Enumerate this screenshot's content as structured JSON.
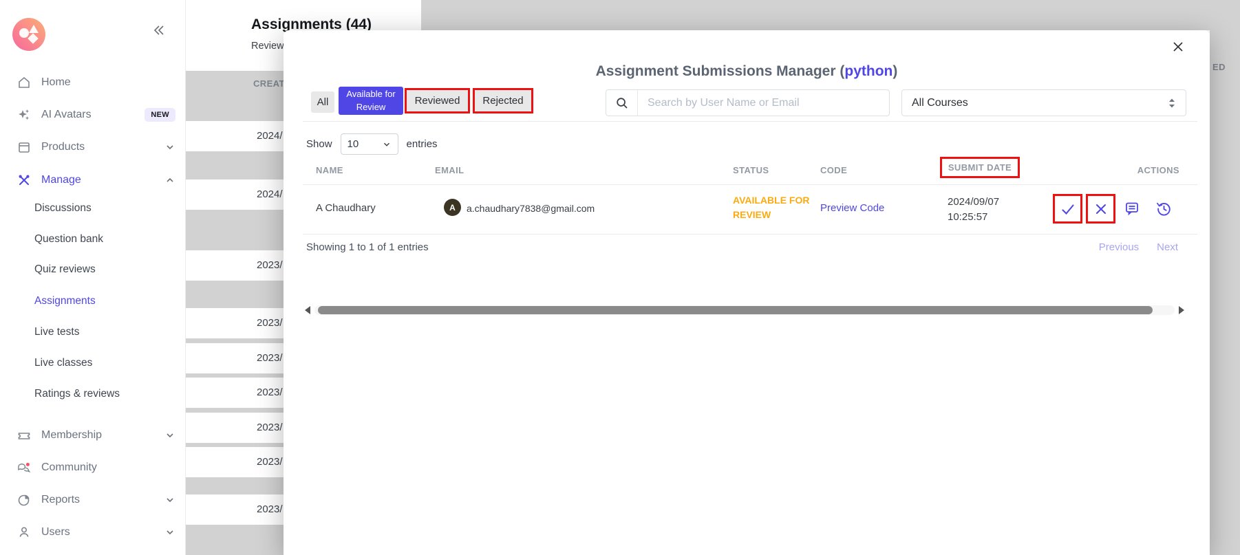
{
  "sidebar": {
    "home": "Home",
    "ai_avatars": "AI Avatars",
    "new_badge": "NEW",
    "products": "Products",
    "manage": "Manage",
    "submenu": [
      "Discussions",
      "Question bank",
      "Quiz reviews",
      "Assignments",
      "Live tests",
      "Live classes",
      "Ratings & reviews"
    ],
    "membership": "Membership",
    "community": "Community",
    "reports": "Reports",
    "users": "Users"
  },
  "background": {
    "page_title": "Assignments (44)",
    "page_subtitle": "Review",
    "left_column_header": "CREAT",
    "right_column_header": "ED",
    "dates": [
      "2024/",
      "2024/",
      "2023/",
      "2023/",
      "2023/",
      "2023/",
      "2023/",
      "2023/",
      "2023/"
    ]
  },
  "modal": {
    "title": {
      "prefix": "Assignment Submissions Manager (",
      "course": "python",
      "suffix": ")"
    },
    "tabs": [
      {
        "label": "All"
      },
      {
        "label": "Available for Review"
      },
      {
        "label": "Reviewed"
      },
      {
        "label": "Rejected"
      }
    ],
    "active_tab": "Available for Review",
    "search_placeholder": "Search by User Name or Email",
    "courses_filter_value": "All Courses",
    "show_label": "Show",
    "page_size": "10",
    "entries_label": "entries",
    "table": {
      "headers": [
        "NAME",
        "EMAIL",
        "STATUS",
        "CODE",
        "SUBMIT DATE",
        "ACTIONS"
      ],
      "row": {
        "name": "A Chaudhary",
        "avatar_initial": "A",
        "email": "a.chaudhary7838@gmail.com",
        "status": "AVAILABLE FOR REVIEW",
        "code_link": "Preview Code",
        "submit_date": "2024/09/07",
        "submit_time": "10:25:57"
      }
    },
    "summary": "Showing 1 to 1 of 1 entries",
    "pagination": {
      "previous": "Previous",
      "next": "Next"
    }
  },
  "colors": {
    "accent": "#4f46e5",
    "status_available": "#fbab10",
    "annotation_red": "#ee1111",
    "logo_pink": "#f8729c"
  }
}
